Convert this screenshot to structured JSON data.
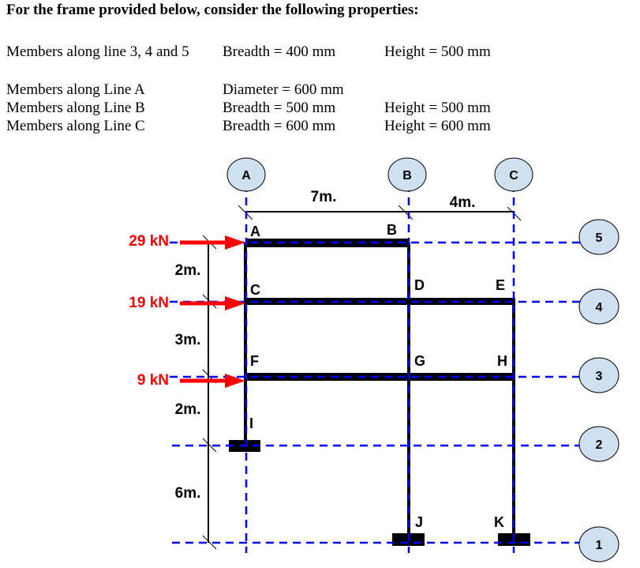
{
  "heading": "For the frame provided below, consider the following properties:",
  "properties": [
    {
      "member": "Members along line 3, 4 and 5",
      "dim1": "Breadth = 400 mm",
      "dim2": "Height = 500 mm"
    },
    {
      "member": "Members along Line A",
      "dim1": "Diameter = 600 mm",
      "dim2": ""
    },
    {
      "member": "Members along Line B",
      "dim1": "Breadth = 500 mm",
      "dim2": "Height = 500 mm"
    },
    {
      "member": "Members along Line C",
      "dim1": "Breadth = 600 mm",
      "dim2": "Height = 600 mm"
    }
  ],
  "diagram": {
    "grid_columns": [
      "A",
      "B",
      "C"
    ],
    "grid_rows": [
      "5",
      "4",
      "3",
      "2",
      "1"
    ],
    "spans": [
      "7m.",
      "4m."
    ],
    "heights": [
      "2m.",
      "3m.",
      "2m.",
      "6m."
    ],
    "loads": [
      "29 kN",
      "19 kN",
      "9 kN"
    ],
    "nodes": [
      "A",
      "B",
      "C",
      "D",
      "E",
      "F",
      "G",
      "H",
      "I",
      "J",
      "K"
    ],
    "colors": {
      "grid": "#0000ff",
      "member": "#000000",
      "load": "#ff0000",
      "bubble": "#cfe0f1"
    }
  }
}
